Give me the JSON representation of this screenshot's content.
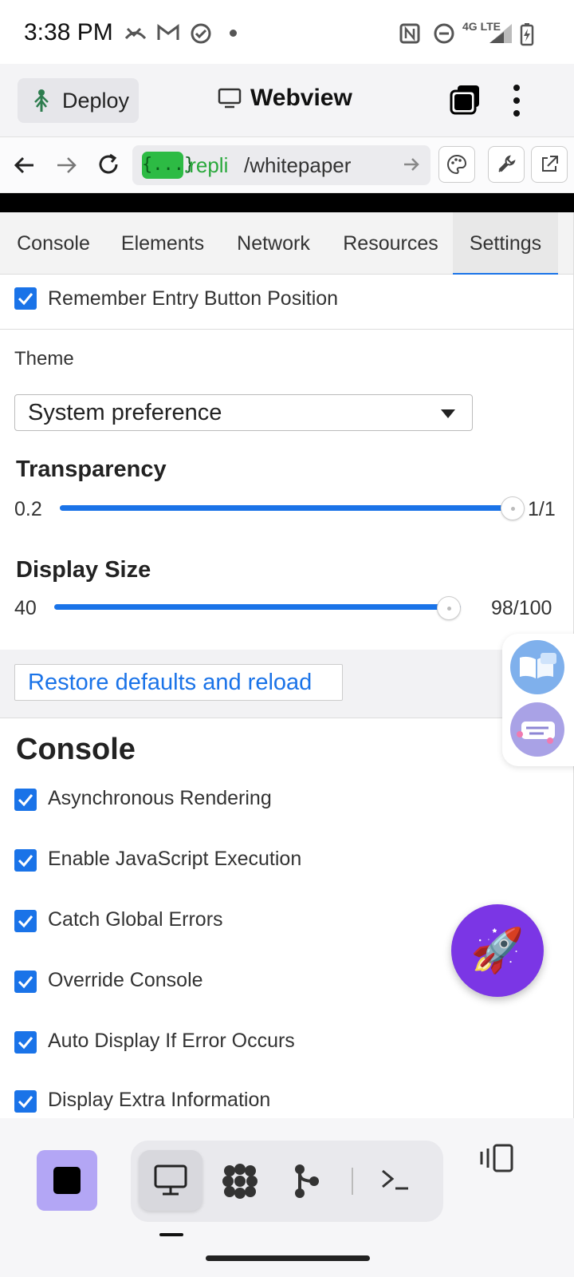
{
  "status_bar": {
    "time": "3:38 PM",
    "network": "4G LTE"
  },
  "top_bar": {
    "deploy_label": "Deploy",
    "title": "Webview"
  },
  "url_bar": {
    "badge": "{...}",
    "domain": ".repli",
    "path": "/whitepaper"
  },
  "tabs": [
    {
      "label": "Console",
      "active": false
    },
    {
      "label": "Elements",
      "active": false
    },
    {
      "label": "Network",
      "active": false
    },
    {
      "label": "Resources",
      "active": false
    },
    {
      "label": "Settings",
      "active": true
    }
  ],
  "settings": {
    "remember_position": {
      "label": "Remember Entry Button Position",
      "checked": true
    },
    "theme": {
      "label": "Theme",
      "value": "System preference"
    },
    "transparency": {
      "label": "Transparency",
      "min_label": "0.2",
      "value_label": "1/1",
      "fraction": 1.0
    },
    "display_size": {
      "label": "Display Size",
      "min_label": "40",
      "value_label": "98/100",
      "fraction": 0.97
    },
    "restore_label": "Restore defaults and reload"
  },
  "console_section": {
    "title": "Console",
    "options": [
      {
        "label": "Asynchronous Rendering",
        "checked": true
      },
      {
        "label": "Enable JavaScript Execution",
        "checked": true
      },
      {
        "label": "Catch Global Errors",
        "checked": true
      },
      {
        "label": "Override Console",
        "checked": true
      },
      {
        "label": "Auto Display If Error Occurs",
        "checked": true
      },
      {
        "label": "Display Extra Information",
        "checked": true
      }
    ]
  },
  "colors": {
    "accent": "#1a73e8",
    "rocket_button": "#7b36e5",
    "stop_button": "#b3a6f5",
    "url_badge": "#2dbb44"
  }
}
